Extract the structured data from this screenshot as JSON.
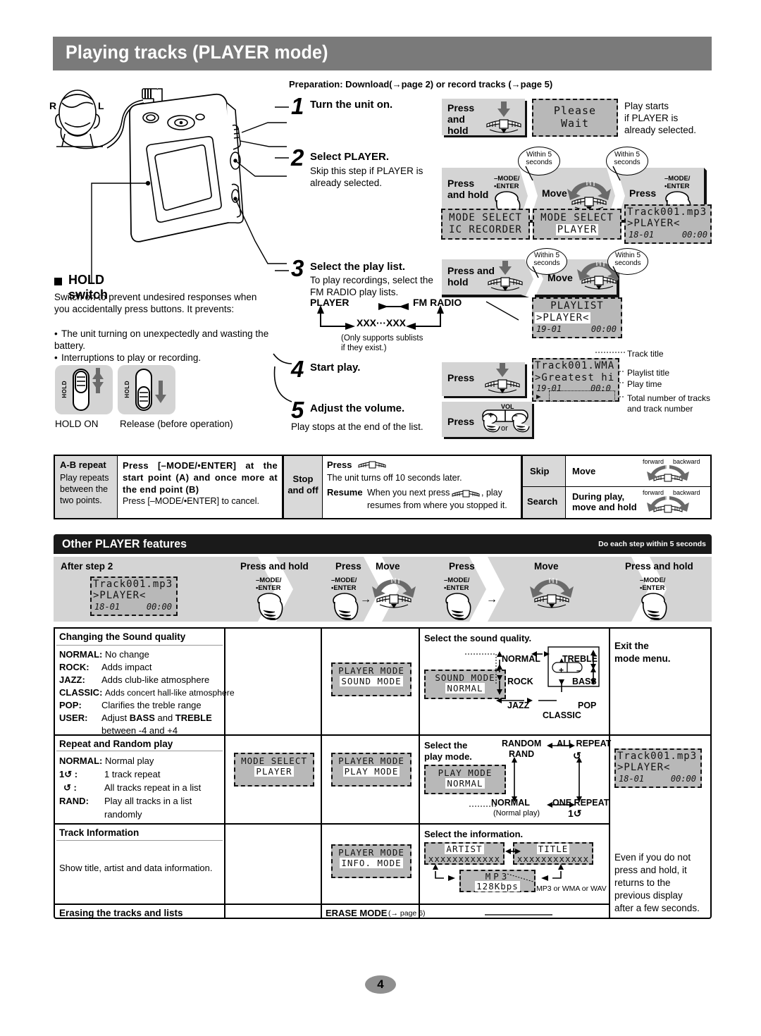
{
  "page": {
    "title": "Playing tracks (PLAYER mode)",
    "number": "4",
    "preparation": "Preparation: Download(→page 2) or record tracks (→page 5)"
  },
  "headset": {
    "right_label": "R",
    "left_label": "L"
  },
  "hold": {
    "heading": "HOLD switch",
    "body": "Switch on to prevent undesired responses when you accidentally press buttons. It prevents:",
    "bullets": [
      "The unit turning on unexpectedly and wasting the battery.",
      "Interruptions to play or recording."
    ],
    "switch_label": "HOLD",
    "caption_on": "HOLD ON",
    "caption_off": "Release (before operation)"
  },
  "steps": [
    {
      "num": "1",
      "head": "Turn the unit on.",
      "sub": "",
      "op1_label": "Press\nand\nhold",
      "note": "Play starts\nif PLAYER is\nalready selected.",
      "lcd": {
        "l1": "Please",
        "l2": "Wait"
      }
    },
    {
      "num": "2",
      "head": "Select PLAYER.",
      "sub": "Skip this step if PLAYER is already selected.",
      "op1_label": "Press\nand hold",
      "op2_label": "Move",
      "op3_label": "Press",
      "btn_label_1": "–MODE/",
      "btn_label_2": "•ENTER",
      "balloon": "Within 5\nseconds",
      "lcd1": {
        "l1": "MODE SELECT",
        "l2": "IC RECORDER"
      },
      "lcd2": {
        "l1": "MODE SELECT",
        "l2": "PLAYER"
      },
      "lcd3": {
        "l1": "Track001.mp3",
        "l2": ">PLAYER<",
        "l3a": "18-01",
        "l3b": "00:00"
      }
    },
    {
      "num": "3",
      "head": "Select the play list.",
      "sub": "To play recordings, select the FM RADIO play lists.",
      "op1_label": "Press and\nhold",
      "op2_label": "Move",
      "balloon": "Within 5\nseconds",
      "flow": {
        "player": "PLAYER",
        "fmradio": "FM RADIO",
        "sublist": "XXX···XXX",
        "note": "(Only supports sublists\nif they exist.)"
      },
      "lcd": {
        "l1": "PLAYLIST",
        "l2": ">PLAYER<",
        "l3a": "19-01",
        "l3b": "00:00"
      }
    },
    {
      "num": "4",
      "head": "Start play.",
      "op1_label": "Press",
      "lcd": {
        "l1": "Track001.WMA",
        "l2": ">Greatest hi",
        "l3a": "19-01",
        "l3b": "00:0"
      },
      "callouts": [
        "Track title",
        "Playlist title",
        "Play time",
        "Total number of tracks\nand track number"
      ]
    },
    {
      "num": "5",
      "head": "Adjust the volume.",
      "sub": "Play stops at the end of the list.",
      "op1_label": "Press",
      "vol_label": "VOL",
      "vol_plus": "+",
      "vol_minus": "–",
      "or_label": "or"
    }
  ],
  "ab_table": {
    "ab_title": "A-B repeat",
    "ab_desc": "Play repeats between the two points.",
    "ab_action_bold": "Press [–MODE/•ENTER] at the start point (A) and once more at the end point (B)",
    "ab_action_plain": "Press [–MODE/•ENTER] to cancel.",
    "stop_title": "Stop\nand off",
    "stop_press": "Press",
    "stop_line1": "The unit turns off 10 seconds later.",
    "resume_bold": "Resume",
    "resume_line1": "When you next press",
    "resume_line1b": ", play",
    "resume_line2": "resumes from where you stopped it.",
    "skip_title": "Skip",
    "skip_action": "Move",
    "search_title": "Search",
    "search_action": "During play,\nmove and hold",
    "forward": "forward",
    "backward": "backward"
  },
  "features": {
    "band_title": "Other PLAYER features",
    "band_note": "Do each step within 5 seconds",
    "strip": [
      {
        "label": "After step 2",
        "kind": "lcd",
        "lcd": {
          "l1": "Track001.mp3",
          "l2": ">PLAYER<",
          "l3a": "18-01",
          "l3b": "00:00"
        }
      },
      {
        "label": "Press and hold",
        "kind": "button",
        "btn1": "–MODE/",
        "btn2": "•ENTER"
      },
      {
        "label": "Press",
        "label2": "Move",
        "kind": "button-dial",
        "btn1": "–MODE/",
        "btn2": "•ENTER"
      },
      {
        "label": "Press",
        "label2": "Move",
        "kind": "button-dial-wide",
        "btn1": "–MODE/",
        "btn2": "•ENTER"
      },
      {
        "label": "Press and hold",
        "kind": "button",
        "btn1": "–MODE/",
        "btn2": "•ENTER"
      }
    ],
    "rows": [
      {
        "title": "Changing the Sound quality",
        "list": [
          {
            "k": "NORMAL",
            "sep": ":",
            "v": "No change"
          },
          {
            "k": "ROCK",
            "sep": ":",
            "v": "Adds impact"
          },
          {
            "k": "JAZZ",
            "sep": ":",
            "v": "Adds club-like atmosphere"
          },
          {
            "k": "CLASSIC",
            "sep": ":",
            "v": "Adds concert hall-like atmosphere"
          },
          {
            "k": "POP",
            "sep": ":",
            "v": "Clarifies the treble range"
          },
          {
            "k": "USER",
            "sep": ":",
            "v": "Adjust BASS and TREBLE"
          },
          {
            "k": "",
            "sep": "",
            "v": "between -4 and +4"
          }
        ],
        "col3_lcd": {
          "l1": "PLAYER MODE",
          "l2": "SOUND MODE"
        },
        "col4_title": "Select the sound quality.",
        "col4_lcd": {
          "l1": "SOUND MODE",
          "l2": "NORMAL"
        },
        "col4_cycle": [
          "NORMAL",
          "ROCK",
          "JAZZ",
          "CLASSIC",
          "POP",
          "BASS",
          "TREBLE"
        ],
        "col4_plus": "+",
        "col4_minus": "–",
        "col5_text": "Exit the\nmode menu."
      },
      {
        "title": "Repeat and Random play",
        "list": [
          {
            "k": "NORMAL",
            "sep": ":",
            "v": "Normal play"
          },
          {
            "k": "1↺",
            "sep": ":",
            "v": "1 track repeat"
          },
          {
            "k": "↺",
            "sep": ":",
            "v": "All tracks repeat in a list"
          },
          {
            "k": "RAND",
            "sep": ":",
            "v": "Play all tracks in a list"
          },
          {
            "k": "",
            "sep": "",
            "v": "randomly"
          }
        ],
        "col2_lcd": {
          "l1": "MODE SELECT",
          "l2": "PLAYER"
        },
        "col3_lcd": {
          "l1": "PLAYER MODE",
          "l2": "PLAY MODE"
        },
        "col4_title": "Select the\nplay mode.",
        "col4_lcd": {
          "l1": "PLAY MODE",
          "l2": "NORMAL"
        },
        "col4_map": {
          "tl": "RANDOM",
          "tl2": "RAND",
          "tr": "ALL REPEAT",
          "tr2": "↺",
          "bl": "NORMAL",
          "bl2": "(Normal play)",
          "br": "ONE REPEAT",
          "br2": "1↺"
        },
        "col5_lcd": {
          "l1": "Track001.mp3",
          "l2": ">PLAYER<",
          "l3a": "18-01",
          "l3b": "00:00"
        }
      },
      {
        "title": "Track Information",
        "body": "Show title, artist and data information.",
        "col3_lcd": {
          "l1": "PLAYER MODE",
          "l2": "INFO. MODE"
        },
        "col4_title": "Select the information.",
        "col4_lcd_a": {
          "l1": "ARTIST",
          "l2": "xxxxxxxxxxxx"
        },
        "col4_lcd_b": {
          "l1": "TITLE",
          "l2": "xxxxxxxxxxxx"
        },
        "col4_lcd_c": {
          "l1": "MP3",
          "l2": "128Kbps"
        },
        "col4_note": "MP3 or WMA or WAV",
        "col5_text": "Even if you do not press and hold, it returns to the previous display after a few seconds."
      },
      {
        "title": "Erasing the tracks and lists",
        "col3_text_bold": "ERASE MODE",
        "col3_text_small": "(→ page 6)"
      }
    ]
  }
}
